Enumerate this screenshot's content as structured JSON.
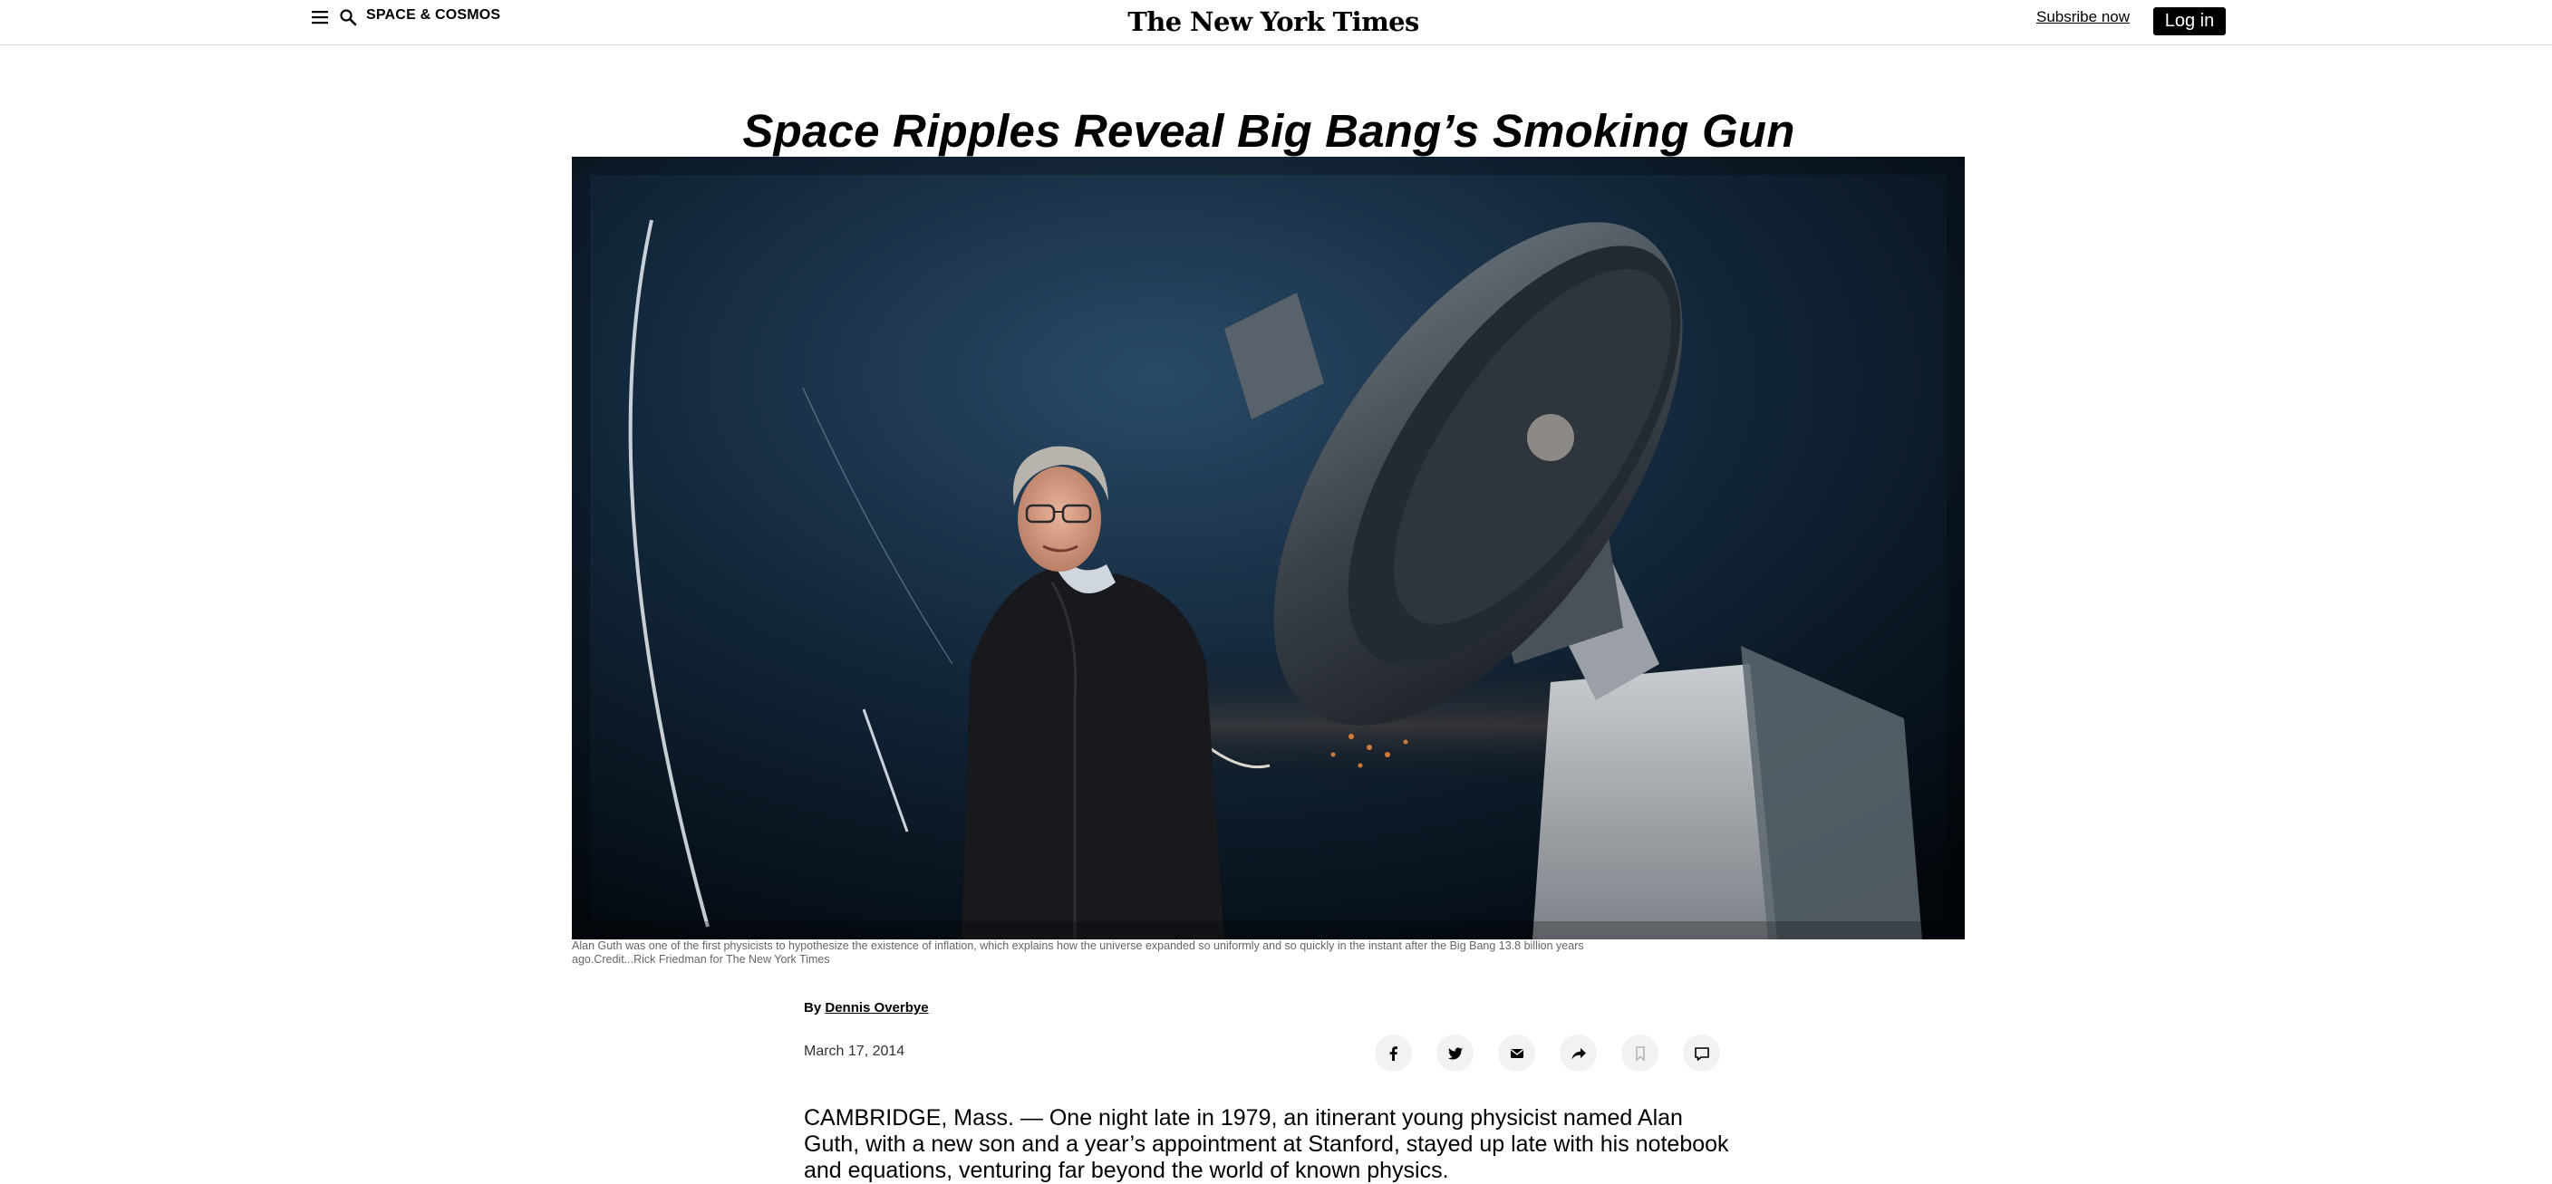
{
  "header": {
    "section": "SPACE & COSMOS",
    "masthead": "The New York Times",
    "subscribe_label": "Subsribe now",
    "login_label": "Log in",
    "icons": [
      "menu-icon",
      "search-icon"
    ]
  },
  "article": {
    "headline": "Space Ripples Reveal Big Bang’s Smoking Gun",
    "image": {
      "alt": "Alan Guth standing beside a telescope at dusk",
      "caption": "Alan Guth was one of the first physicists to hypothesize the existence of inflation, which explains how the universe expanded so uniformly and so quickly in the instant after the Big Bang 13.8 billion years ago.",
      "credit": "Credit...Rick Friedman for The New York Times"
    },
    "byline_prefix": "By",
    "author": "Dennis Overbye",
    "date": "March 17, 2014",
    "share_icons": [
      "facebook-icon",
      "twitter-icon",
      "email-icon",
      "share-icon",
      "bookmark-icon",
      "comment-icon"
    ],
    "body": "CAMBRIDGE, Mass. — One night late in 1979, an itinerant young physicist named Alan Guth, with a new son and a year’s appointment at Stanford, stayed up late with his notebook and equations, venturing far beyond the world of known physics."
  },
  "colors": {
    "text": "#121212",
    "button_bg": "#000000",
    "share_bg": "#f2f2f2",
    "caption": "#666666"
  }
}
